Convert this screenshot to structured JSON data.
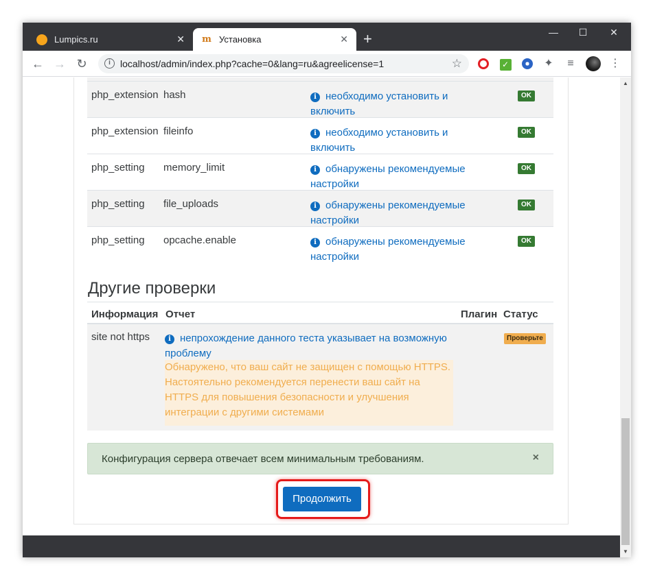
{
  "browser": {
    "tabs": [
      {
        "title": "Lumpics.ru",
        "active": false
      },
      {
        "title": "Установка",
        "active": true
      }
    ],
    "new_tab": "+",
    "window_controls": {
      "minimize": "—",
      "maximize": "☐",
      "close": "✕"
    },
    "tab_close": "✕",
    "url": "localhost/admin/index.php?cache=0&lang=ru&agreelicense=1",
    "nav": {
      "back": "←",
      "forward": "→",
      "reload": "↻"
    },
    "star": "☆",
    "menu": "⋮"
  },
  "php_checks": [
    {
      "type": "php_extension",
      "name": "hash",
      "report": "необходимо установить и включить",
      "status": "OK"
    },
    {
      "type": "php_extension",
      "name": "fileinfo",
      "report": "необходимо установить и включить",
      "status": "OK"
    },
    {
      "type": "php_setting",
      "name": "memory_limit",
      "report": "обнаружены рекомендуемые настройки",
      "status": "OK"
    },
    {
      "type": "php_setting",
      "name": "file_uploads",
      "report": "обнаружены рекомендуемые настройки",
      "status": "OK"
    },
    {
      "type": "php_setting",
      "name": "opcache.enable",
      "report": "обнаружены рекомендуемые настройки",
      "status": "OK"
    }
  ],
  "other_checks": {
    "title": "Другие проверки",
    "headers": {
      "info": "Информация",
      "report": "Отчет",
      "plugin": "Плагин",
      "status": "Статус"
    },
    "row": {
      "info": "site not https",
      "report": "непрохождение данного теста указывает на возможную проблему",
      "warning": "Обнаружено, что ваш сайт не защищен с помощью HTTPS. Настоятельно рекомендуется перенести ваш сайт на HTTPS для повышения безопасности и улучшения интеграции с другими системами",
      "status": "Проверьте"
    }
  },
  "alert": {
    "message": "Конфигурация сервера отвечает всем минимальным требованиям.",
    "close": "×"
  },
  "continue_button": "Продолжить",
  "colors": {
    "link": "#0f6cbf",
    "ok_badge": "#357a32",
    "warn_badge": "#f0ad4e",
    "highlight": "#e51a1a"
  }
}
